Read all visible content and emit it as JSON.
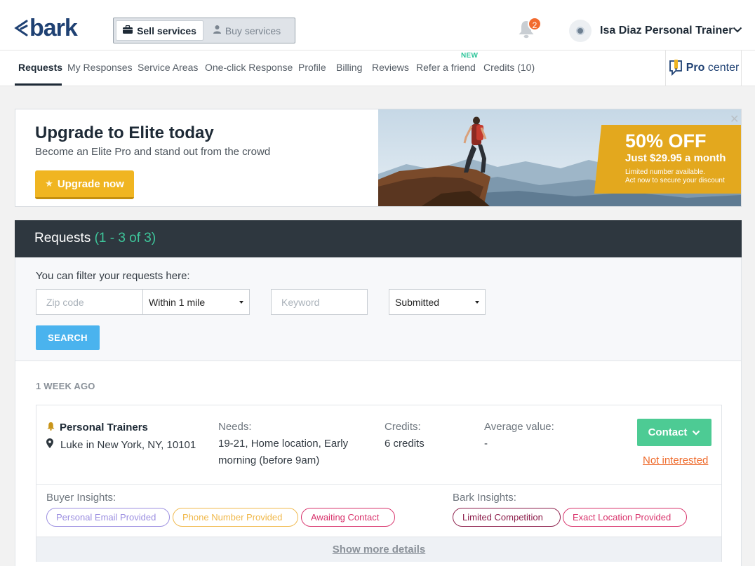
{
  "header": {
    "logo_text": "bark",
    "mode_switch": {
      "sell_label": "Sell services",
      "buy_label": "Buy services"
    },
    "notification_count": "2",
    "user_name": "Isa Diaz Personal Trainer"
  },
  "nav": {
    "items": [
      {
        "label": "Requests",
        "active": true
      },
      {
        "label": "My Responses"
      },
      {
        "label": "Service Areas"
      },
      {
        "label": "One-click Response"
      },
      {
        "label": "Profile"
      },
      {
        "label": "Billing"
      },
      {
        "label": "Reviews"
      },
      {
        "label": "Refer a friend",
        "tag": "NEW"
      },
      {
        "label": "Credits (10)"
      }
    ],
    "procenter": {
      "bold": "Pro",
      "rest": "center"
    }
  },
  "banner": {
    "title": "Upgrade to Elite today",
    "subtitle": "Become an Elite Pro and stand out from the crowd",
    "button_label": "Upgrade now",
    "promo_big": "50% OFF",
    "promo_price": "Just $29.95 a month",
    "promo_small_1": "Limited number available.",
    "promo_small_2": "Act now to secure your discount",
    "close_glyph": "✕"
  },
  "requests": {
    "title": "Requests",
    "count": "(1 - 3 of 3)",
    "filter_label": "You can filter your requests here:",
    "zip_placeholder": "Zip code",
    "distance_value": "Within 1 mile",
    "keyword_placeholder": "Keyword",
    "status_value": "Submitted",
    "search_label": "SEARCH",
    "group_label": "1 WEEK AGO",
    "card": {
      "service": "Personal Trainers",
      "location": "Luke in New York, NY, 10101",
      "needs_label": "Needs:",
      "needs_line1": "19-21, Home location, Early",
      "needs_line2": "morning (before 9am)",
      "credits_label": "Credits:",
      "credits_value": "6 credits",
      "avg_label": "Average value:",
      "avg_value": "-",
      "contact_label": "Contact",
      "not_interested_label": "Not interested",
      "buyer_insights_label": "Buyer Insights:",
      "bark_insights_label": "Bark Insights:",
      "buyer_pills": [
        {
          "label": "Personal Email Provided",
          "color": "#9b8ee0"
        },
        {
          "label": "Phone Number Provided",
          "color": "#f0b84a"
        },
        {
          "label": "Awaiting Contact",
          "color": "#d8326b"
        }
      ],
      "bark_pills": [
        {
          "label": "Limited Competition",
          "color": "#8c1d4a"
        },
        {
          "label": "Exact Location Provided",
          "color": "#d8326b"
        }
      ],
      "show_more_label": "Show more details"
    }
  },
  "colors": {
    "brand": "#1f4173",
    "accent_green": "#4dcb94",
    "accent_orange": "#ef6b2c",
    "header_dark": "#2e373f",
    "search_blue": "#4ab3ee",
    "gold": "#f0b521"
  }
}
